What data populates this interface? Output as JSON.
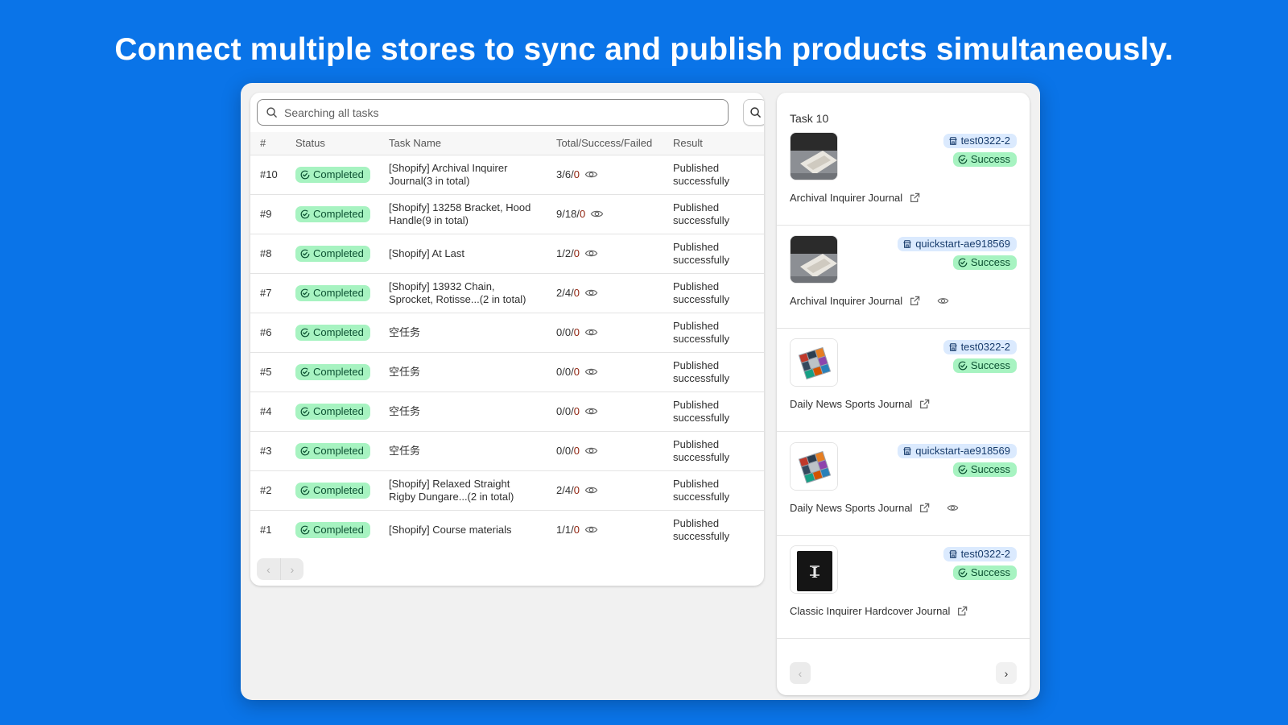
{
  "headline": "Connect multiple stores to sync and publish products simultaneously.",
  "search": {
    "placeholder": "Searching all tasks",
    "button_icon": "search-icon"
  },
  "table": {
    "headers": [
      "#",
      "Status",
      "Task Name",
      "Total/Success/Failed",
      "Result"
    ],
    "rows": [
      {
        "id": "#10",
        "status": "Completed",
        "name": "[Shopify] Archival Inquirer Journal(3 in total)",
        "total": "3",
        "success": "6",
        "failed": "0",
        "result": "Published successfully"
      },
      {
        "id": "#9",
        "status": "Completed",
        "name": "[Shopify] 13258 Bracket, Hood Handle(9 in total)",
        "total": "9",
        "success": "18",
        "failed": "0",
        "result": "Published successfully"
      },
      {
        "id": "#8",
        "status": "Completed",
        "name": "[Shopify] At Last",
        "total": "1",
        "success": "2",
        "failed": "0",
        "result": "Published successfully"
      },
      {
        "id": "#7",
        "status": "Completed",
        "name": "[Shopify] 13932 Chain, Sprocket, Rotisse...(2 in total)",
        "total": "2",
        "success": "4",
        "failed": "0",
        "result": "Published successfully"
      },
      {
        "id": "#6",
        "status": "Completed",
        "name": "空任务",
        "total": "0",
        "success": "0",
        "failed": "0",
        "result": "Published successfully"
      },
      {
        "id": "#5",
        "status": "Completed",
        "name": "空任务",
        "total": "0",
        "success": "0",
        "failed": "0",
        "result": "Published successfully"
      },
      {
        "id": "#4",
        "status": "Completed",
        "name": "空任务",
        "total": "0",
        "success": "0",
        "failed": "0",
        "result": "Published successfully"
      },
      {
        "id": "#3",
        "status": "Completed",
        "name": "空任务",
        "total": "0",
        "success": "0",
        "failed": "0",
        "result": "Published successfully"
      },
      {
        "id": "#2",
        "status": "Completed",
        "name": "[Shopify] Relaxed Straight Rigby Dungare...(2 in total)",
        "total": "2",
        "success": "4",
        "failed": "0",
        "result": "Published successfully"
      },
      {
        "id": "#1",
        "status": "Completed",
        "name": "[Shopify] Course materials",
        "total": "1",
        "success": "1",
        "failed": "0",
        "result": "Published successfully"
      }
    ],
    "pager": {
      "prev": "‹",
      "next": "›"
    }
  },
  "detail": {
    "title": "Task 10",
    "products": [
      {
        "store": "test0322-2",
        "status": "Success",
        "name": "Archival Inquirer Journal",
        "thumb": "journal-photo",
        "show_eye": false
      },
      {
        "store": "quickstart-ae918569",
        "status": "Success",
        "name": "Archival Inquirer Journal",
        "thumb": "journal-photo",
        "show_eye": true
      },
      {
        "store": "test0322-2",
        "status": "Success",
        "name": "Daily News Sports Journal",
        "thumb": "collage-journal",
        "show_eye": false
      },
      {
        "store": "quickstart-ae918569",
        "status": "Success",
        "name": "Daily News Sports Journal",
        "thumb": "collage-journal",
        "show_eye": true
      },
      {
        "store": "test0322-2",
        "status": "Success",
        "name": "Classic Inquirer Hardcover Journal",
        "thumb": "hardcover-journal",
        "show_eye": false
      }
    ],
    "pager": {
      "prev": "‹",
      "next": "›"
    }
  },
  "colors": {
    "background": "#0a74e8",
    "success_badge": "#a7f3c1",
    "store_badge": "#dbeafe",
    "failed_text": "#8e1f0b"
  }
}
